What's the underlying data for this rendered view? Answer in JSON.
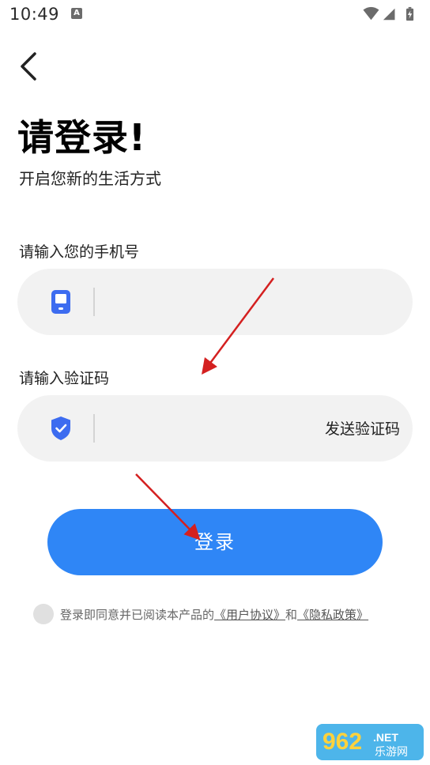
{
  "status_bar": {
    "time": "10:49",
    "notification_badge": "A"
  },
  "header": {
    "title": "请登录!",
    "subtitle": "开启您新的生活方式"
  },
  "phone_field": {
    "label": "请输入您的手机号",
    "value": "",
    "icon": "phone-icon"
  },
  "code_field": {
    "label": "请输入验证码",
    "value": "",
    "icon": "shield-check-icon",
    "send_code_label": "发送验证码"
  },
  "login_button": {
    "label": "登录"
  },
  "agreement": {
    "checked": false,
    "prefix": "登录即同意并已阅读本产品的",
    "user_agreement": "《用户协议》",
    "conjunction": "和",
    "privacy_policy": "《隐私政策》"
  },
  "watermark": {
    "text_main": "962",
    "text_suffix": ".NET",
    "text_sub": "乐游网"
  },
  "colors": {
    "primary": "#2f86f6",
    "icon": "#3d6cf0",
    "input_bg": "#f2f2f2",
    "annotation_arrow": "#d42020"
  }
}
